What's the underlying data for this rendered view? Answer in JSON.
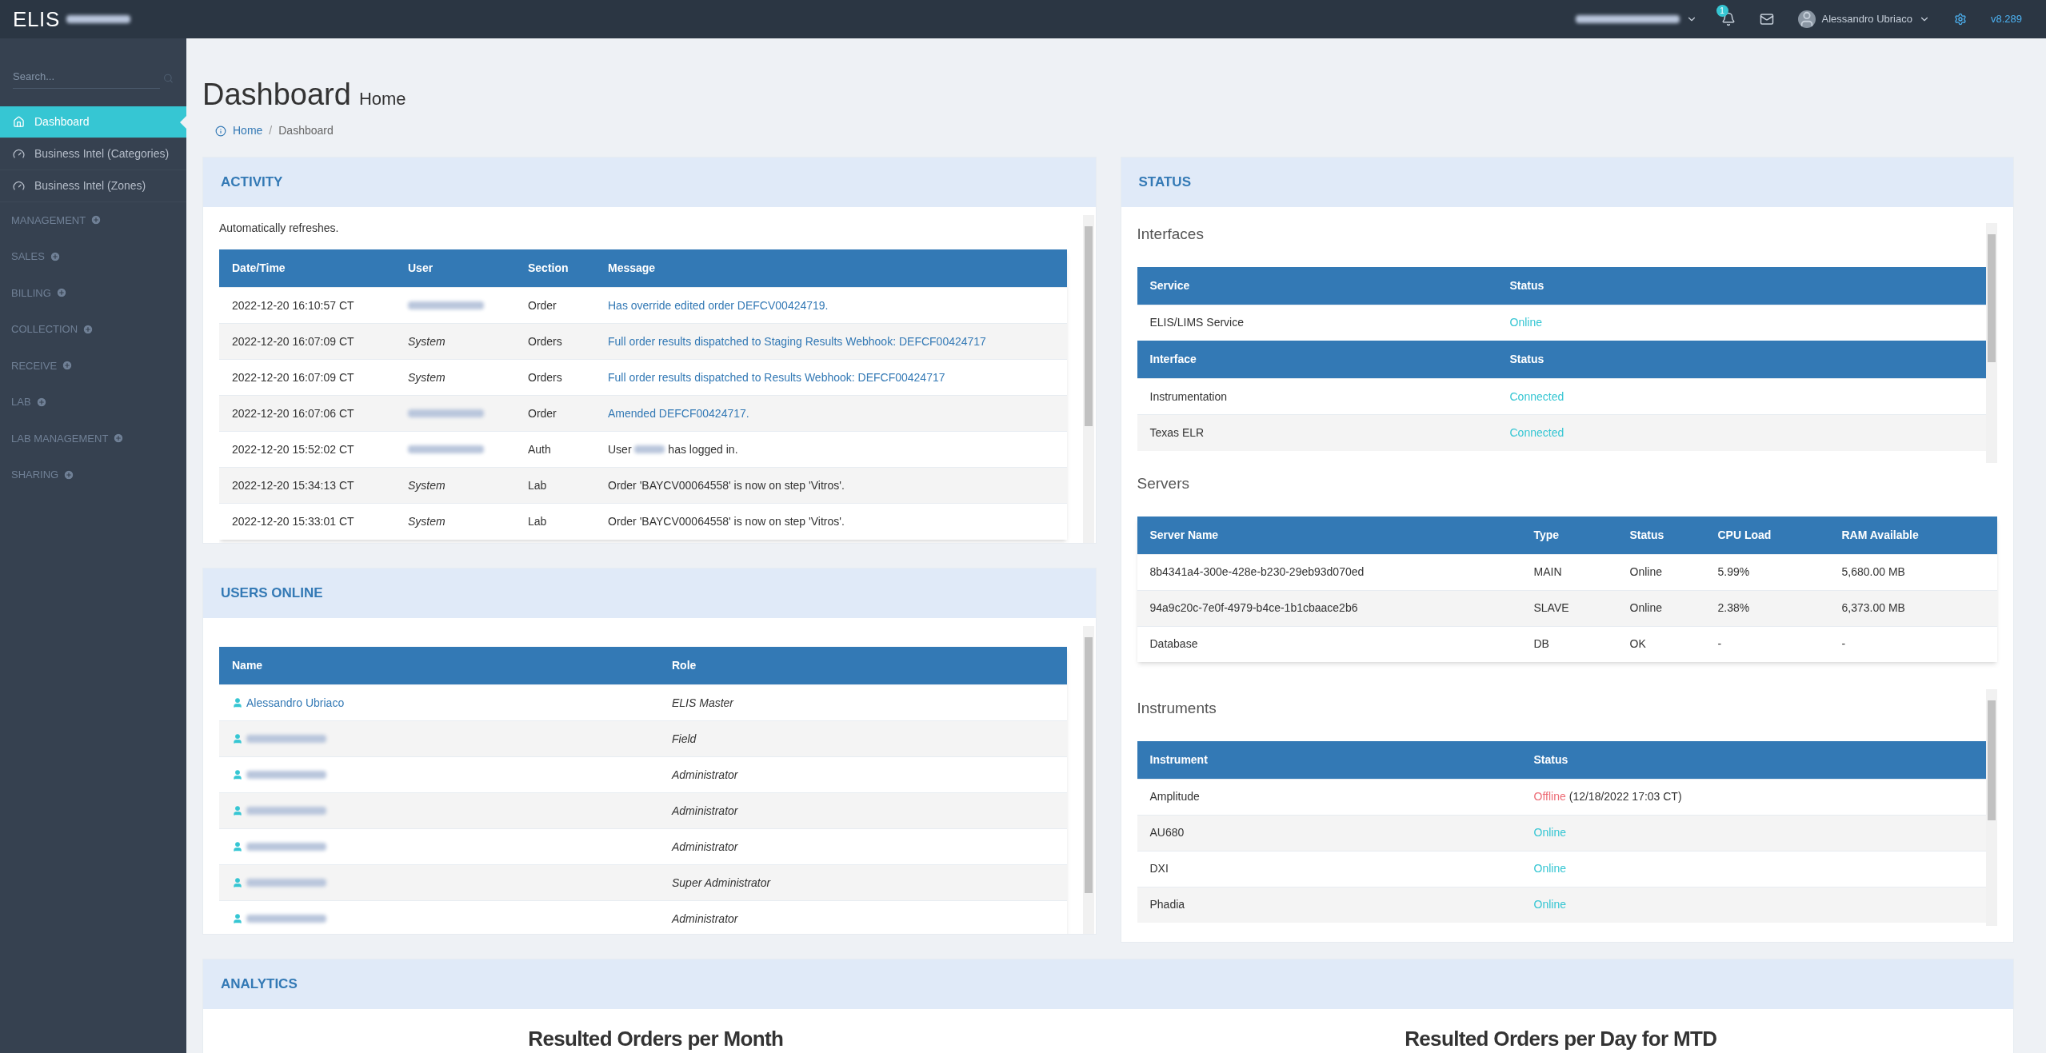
{
  "topbar": {
    "logo": "ELIS",
    "notification_count": "1",
    "user_name": "Alessandro Ubriaco",
    "version": "v8.289"
  },
  "sidebar": {
    "search": {
      "placeholder": "Search..."
    },
    "items": [
      {
        "label": "Dashboard",
        "kind": "link",
        "selected": true
      },
      {
        "label": "Business Intel (Categories)",
        "kind": "link",
        "selected": false
      },
      {
        "label": "Business Intel (Zones)",
        "kind": "link",
        "selected": false
      },
      {
        "label": "MANAGEMENT",
        "kind": "group",
        "selected": false
      },
      {
        "label": "SALES",
        "kind": "group",
        "selected": false
      },
      {
        "label": "BILLING",
        "kind": "group",
        "selected": false
      },
      {
        "label": "COLLECTION",
        "kind": "group",
        "selected": false
      },
      {
        "label": "RECEIVE",
        "kind": "group",
        "selected": false
      },
      {
        "label": "LAB",
        "kind": "group",
        "selected": false
      },
      {
        "label": "LAB MANAGEMENT",
        "kind": "group",
        "selected": false
      },
      {
        "label": "SHARING",
        "kind": "group",
        "selected": false
      }
    ]
  },
  "page": {
    "title": "Dashboard",
    "subtitle": "Home",
    "breadcrumb": [
      {
        "label": "Home",
        "kind": "link"
      },
      {
        "label": "/",
        "kind": "separator"
      },
      {
        "label": "Dashboard",
        "kind": "current"
      }
    ]
  },
  "activity": {
    "title": "ACTIVITY",
    "note": "Automatically refreshes.",
    "columns": [
      "Date/Time",
      "User",
      "Section",
      "Message"
    ],
    "rows": [
      {
        "time": "2022-12-20 16:10:57 CT",
        "section": "Order",
        "message": "Has override edited order DEFCV00424719.",
        "kind": "link"
      },
      {
        "time": "2022-12-20 16:07:09 CT",
        "user": "System",
        "section": "Orders",
        "message": "Full order results dispatched to Staging Results Webhook: DEFCF00424717",
        "kind": "link"
      },
      {
        "time": "2022-12-20 16:07:09 CT",
        "user": "System",
        "section": "Orders",
        "message": "Full order results dispatched to Results Webhook: DEFCF00424717",
        "kind": "link"
      },
      {
        "time": "2022-12-20 16:07:06 CT",
        "section": "Order",
        "message": "Amended DEFCF00424717.",
        "kind": "link"
      },
      {
        "time": "2022-12-20 15:52:02 CT",
        "section": "Auth",
        "message": "User",
        "message_after": "has logged in.",
        "kind": "login"
      },
      {
        "time": "2022-12-20 15:34:13 CT",
        "user": "System",
        "section": "Lab",
        "message": "Order 'BAYCV00064558' is now on step 'Vitros'.",
        "kind": "text"
      },
      {
        "time": "2022-12-20 15:33:01 CT",
        "user": "System",
        "section": "Lab",
        "message": "Order 'BAYCV00064558' is now on step 'Vitros'.",
        "kind": "text"
      }
    ]
  },
  "users_online": {
    "title": "USERS ONLINE",
    "columns": [
      "Name",
      "Role"
    ],
    "rows": [
      {
        "name": "Alessandro Ubriaco",
        "role": "ELIS Master"
      },
      {
        "role": "Field"
      },
      {
        "role": "Administrator"
      },
      {
        "role": "Administrator"
      },
      {
        "role": "Administrator"
      },
      {
        "role": "Super Administrator"
      },
      {
        "role": "Administrator"
      }
    ]
  },
  "status": {
    "title": "STATUS",
    "interfaces": {
      "title": "Interfaces",
      "service_columns": [
        "Service",
        "Status"
      ],
      "services": [
        {
          "name": "ELIS/LIMS Service",
          "status": "Online",
          "color": "#36c6d3"
        }
      ],
      "interface_columns": [
        "Interface",
        "Status"
      ],
      "interfaces": [
        {
          "name": "Instrumentation",
          "status": "Connected",
          "color": "#36c6d3"
        },
        {
          "name": "Texas ELR",
          "status": "Connected",
          "color": "#36c6d3"
        }
      ]
    },
    "servers": {
      "title": "Servers",
      "columns": [
        "Server Name",
        "Type",
        "Status",
        "CPU Load",
        "RAM Available"
      ],
      "rows": [
        {
          "name": "8b4341a4-300e-428e-b230-29eb93d070ed",
          "type": "MAIN",
          "status": "Online",
          "cpu": "5.99%",
          "ram": "5,680.00 MB"
        },
        {
          "name": "94a9c20c-7e0f-4979-b4ce-1b1cbaace2b6",
          "type": "SLAVE",
          "status": "Online",
          "cpu": "2.38%",
          "ram": "6,373.00 MB"
        },
        {
          "name": "Database",
          "type": "DB",
          "status": "OK",
          "cpu": "-",
          "ram": "-"
        }
      ]
    },
    "instruments": {
      "title": "Instruments",
      "columns": [
        "Instrument",
        "Status"
      ],
      "rows": [
        {
          "name": "Amplitude",
          "status": "Offline",
          "color": "#ed6b75",
          "since": "(12/18/2022 17:03 CT)"
        },
        {
          "name": "AU680",
          "status": "Online",
          "color": "#36c6d3"
        },
        {
          "name": "DXI",
          "status": "Online",
          "color": "#36c6d3"
        },
        {
          "name": "Phadia",
          "status": "Online",
          "color": "#36c6d3"
        }
      ]
    }
  },
  "analytics": {
    "title": "ANALYTICS",
    "chart_titles": [
      "Resulted Orders per Month",
      "Resulted Orders per Day for MTD"
    ]
  }
}
